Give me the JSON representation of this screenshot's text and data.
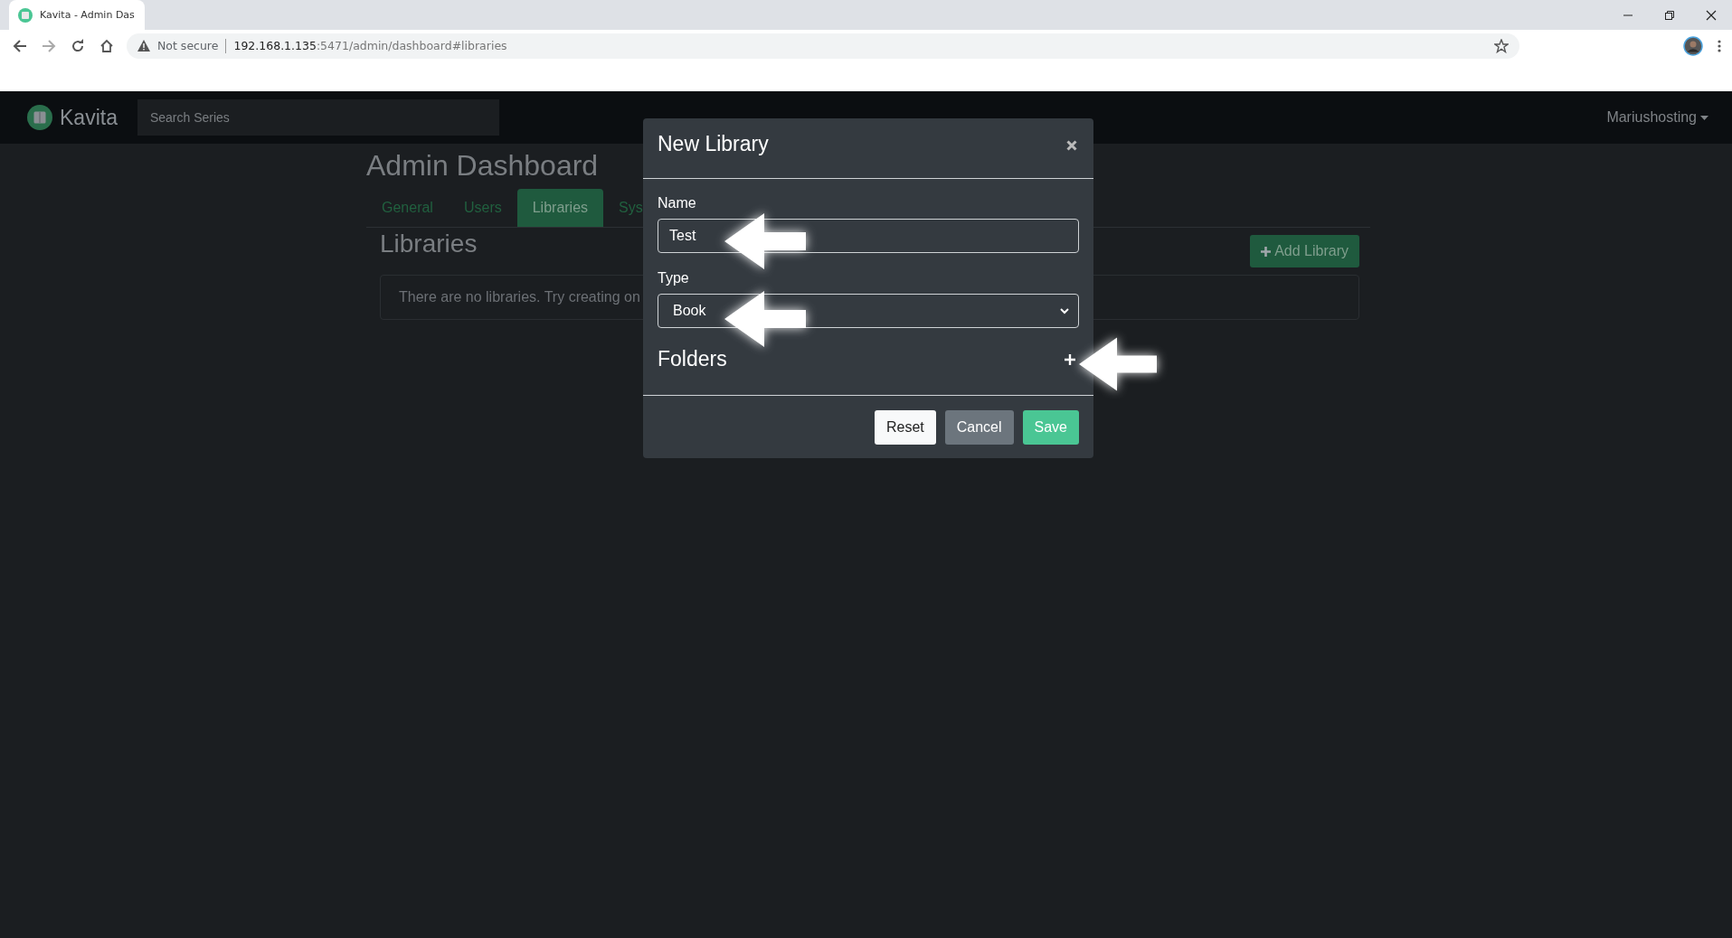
{
  "browser": {
    "tab_title": "Kavita - Admin Das",
    "security": "Not secure",
    "host": "192.168.1.135",
    "path": ":5471/admin/dashboard#libraries"
  },
  "navbar": {
    "brand": "Kavita",
    "search": {
      "placeholder": "Search Series"
    },
    "user_menu": "Mariushosting"
  },
  "dashboard": {
    "title": "Admin Dashboard",
    "tabs": [
      {
        "label": "General",
        "selected": false
      },
      {
        "label": "Users",
        "selected": false
      },
      {
        "label": "Libraries",
        "selected": true
      },
      {
        "label": "Sys",
        "selected": false
      }
    ],
    "section_title": "Libraries",
    "add_button": "Add Library",
    "empty_message": "There are no libraries. Try creating on"
  },
  "modal": {
    "title": "New Library",
    "fields": [
      {
        "kind": "text",
        "label": "Name",
        "value": "Test"
      },
      {
        "kind": "select",
        "label": "Type",
        "value": "Book"
      }
    ],
    "folders_heading": "Folders",
    "buttons": [
      {
        "label": "Reset",
        "kind": "light"
      },
      {
        "label": "Cancel",
        "kind": "secondary"
      },
      {
        "label": "Save",
        "kind": "primary"
      }
    ]
  }
}
